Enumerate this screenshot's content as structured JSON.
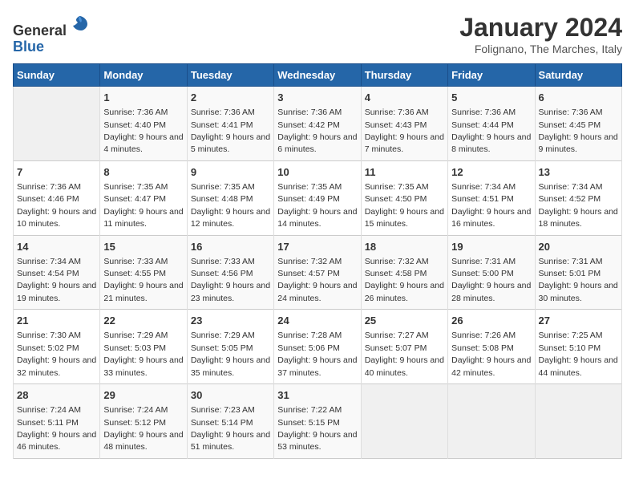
{
  "header": {
    "logo_general": "General",
    "logo_blue": "Blue",
    "month_title": "January 2024",
    "location": "Folignano, The Marches, Italy"
  },
  "days_of_week": [
    "Sunday",
    "Monday",
    "Tuesday",
    "Wednesday",
    "Thursday",
    "Friday",
    "Saturday"
  ],
  "weeks": [
    [
      {
        "day": "",
        "empty": true
      },
      {
        "day": "1",
        "sunrise": "Sunrise: 7:36 AM",
        "sunset": "Sunset: 4:40 PM",
        "daylight": "Daylight: 9 hours and 4 minutes."
      },
      {
        "day": "2",
        "sunrise": "Sunrise: 7:36 AM",
        "sunset": "Sunset: 4:41 PM",
        "daylight": "Daylight: 9 hours and 5 minutes."
      },
      {
        "day": "3",
        "sunrise": "Sunrise: 7:36 AM",
        "sunset": "Sunset: 4:42 PM",
        "daylight": "Daylight: 9 hours and 6 minutes."
      },
      {
        "day": "4",
        "sunrise": "Sunrise: 7:36 AM",
        "sunset": "Sunset: 4:43 PM",
        "daylight": "Daylight: 9 hours and 7 minutes."
      },
      {
        "day": "5",
        "sunrise": "Sunrise: 7:36 AM",
        "sunset": "Sunset: 4:44 PM",
        "daylight": "Daylight: 9 hours and 8 minutes."
      },
      {
        "day": "6",
        "sunrise": "Sunrise: 7:36 AM",
        "sunset": "Sunset: 4:45 PM",
        "daylight": "Daylight: 9 hours and 9 minutes."
      }
    ],
    [
      {
        "day": "7",
        "sunrise": "Sunrise: 7:36 AM",
        "sunset": "Sunset: 4:46 PM",
        "daylight": "Daylight: 9 hours and 10 minutes."
      },
      {
        "day": "8",
        "sunrise": "Sunrise: 7:35 AM",
        "sunset": "Sunset: 4:47 PM",
        "daylight": "Daylight: 9 hours and 11 minutes."
      },
      {
        "day": "9",
        "sunrise": "Sunrise: 7:35 AM",
        "sunset": "Sunset: 4:48 PM",
        "daylight": "Daylight: 9 hours and 12 minutes."
      },
      {
        "day": "10",
        "sunrise": "Sunrise: 7:35 AM",
        "sunset": "Sunset: 4:49 PM",
        "daylight": "Daylight: 9 hours and 14 minutes."
      },
      {
        "day": "11",
        "sunrise": "Sunrise: 7:35 AM",
        "sunset": "Sunset: 4:50 PM",
        "daylight": "Daylight: 9 hours and 15 minutes."
      },
      {
        "day": "12",
        "sunrise": "Sunrise: 7:34 AM",
        "sunset": "Sunset: 4:51 PM",
        "daylight": "Daylight: 9 hours and 16 minutes."
      },
      {
        "day": "13",
        "sunrise": "Sunrise: 7:34 AM",
        "sunset": "Sunset: 4:52 PM",
        "daylight": "Daylight: 9 hours and 18 minutes."
      }
    ],
    [
      {
        "day": "14",
        "sunrise": "Sunrise: 7:34 AM",
        "sunset": "Sunset: 4:54 PM",
        "daylight": "Daylight: 9 hours and 19 minutes."
      },
      {
        "day": "15",
        "sunrise": "Sunrise: 7:33 AM",
        "sunset": "Sunset: 4:55 PM",
        "daylight": "Daylight: 9 hours and 21 minutes."
      },
      {
        "day": "16",
        "sunrise": "Sunrise: 7:33 AM",
        "sunset": "Sunset: 4:56 PM",
        "daylight": "Daylight: 9 hours and 23 minutes."
      },
      {
        "day": "17",
        "sunrise": "Sunrise: 7:32 AM",
        "sunset": "Sunset: 4:57 PM",
        "daylight": "Daylight: 9 hours and 24 minutes."
      },
      {
        "day": "18",
        "sunrise": "Sunrise: 7:32 AM",
        "sunset": "Sunset: 4:58 PM",
        "daylight": "Daylight: 9 hours and 26 minutes."
      },
      {
        "day": "19",
        "sunrise": "Sunrise: 7:31 AM",
        "sunset": "Sunset: 5:00 PM",
        "daylight": "Daylight: 9 hours and 28 minutes."
      },
      {
        "day": "20",
        "sunrise": "Sunrise: 7:31 AM",
        "sunset": "Sunset: 5:01 PM",
        "daylight": "Daylight: 9 hours and 30 minutes."
      }
    ],
    [
      {
        "day": "21",
        "sunrise": "Sunrise: 7:30 AM",
        "sunset": "Sunset: 5:02 PM",
        "daylight": "Daylight: 9 hours and 32 minutes."
      },
      {
        "day": "22",
        "sunrise": "Sunrise: 7:29 AM",
        "sunset": "Sunset: 5:03 PM",
        "daylight": "Daylight: 9 hours and 33 minutes."
      },
      {
        "day": "23",
        "sunrise": "Sunrise: 7:29 AM",
        "sunset": "Sunset: 5:05 PM",
        "daylight": "Daylight: 9 hours and 35 minutes."
      },
      {
        "day": "24",
        "sunrise": "Sunrise: 7:28 AM",
        "sunset": "Sunset: 5:06 PM",
        "daylight": "Daylight: 9 hours and 37 minutes."
      },
      {
        "day": "25",
        "sunrise": "Sunrise: 7:27 AM",
        "sunset": "Sunset: 5:07 PM",
        "daylight": "Daylight: 9 hours and 40 minutes."
      },
      {
        "day": "26",
        "sunrise": "Sunrise: 7:26 AM",
        "sunset": "Sunset: 5:08 PM",
        "daylight": "Daylight: 9 hours and 42 minutes."
      },
      {
        "day": "27",
        "sunrise": "Sunrise: 7:25 AM",
        "sunset": "Sunset: 5:10 PM",
        "daylight": "Daylight: 9 hours and 44 minutes."
      }
    ],
    [
      {
        "day": "28",
        "sunrise": "Sunrise: 7:24 AM",
        "sunset": "Sunset: 5:11 PM",
        "daylight": "Daylight: 9 hours and 46 minutes."
      },
      {
        "day": "29",
        "sunrise": "Sunrise: 7:24 AM",
        "sunset": "Sunset: 5:12 PM",
        "daylight": "Daylight: 9 hours and 48 minutes."
      },
      {
        "day": "30",
        "sunrise": "Sunrise: 7:23 AM",
        "sunset": "Sunset: 5:14 PM",
        "daylight": "Daylight: 9 hours and 51 minutes."
      },
      {
        "day": "31",
        "sunrise": "Sunrise: 7:22 AM",
        "sunset": "Sunset: 5:15 PM",
        "daylight": "Daylight: 9 hours and 53 minutes."
      },
      {
        "day": "",
        "empty": true
      },
      {
        "day": "",
        "empty": true
      },
      {
        "day": "",
        "empty": true
      }
    ]
  ]
}
